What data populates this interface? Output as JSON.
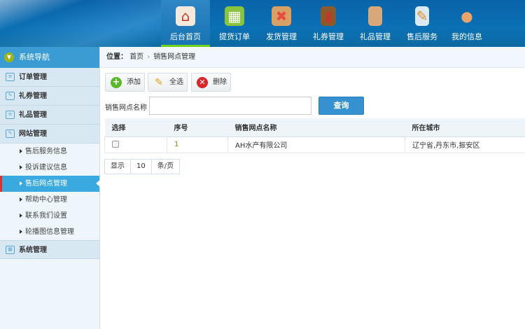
{
  "header": {
    "nav": [
      {
        "label": "后台首页",
        "icon": "house-icon",
        "active": true
      },
      {
        "label": "提货订单",
        "icon": "basket-icon"
      },
      {
        "label": "发货管理",
        "icon": "package-icon"
      },
      {
        "label": "礼券管理",
        "icon": "book-icon"
      },
      {
        "label": "礼品管理",
        "icon": "gift-bag-icon"
      },
      {
        "label": "售后服务",
        "icon": "document-pencil-icon"
      },
      {
        "label": "我的信息",
        "icon": "user-icon"
      }
    ]
  },
  "sidebar": {
    "title": "系统导航",
    "groups": [
      {
        "label": "订单管理"
      },
      {
        "label": "礼券管理"
      },
      {
        "label": "礼品管理"
      },
      {
        "label": "网站管理"
      }
    ],
    "sub": [
      {
        "label": "售后服务信息"
      },
      {
        "label": "投诉建议信息"
      },
      {
        "label": "售后网点管理",
        "active": true
      },
      {
        "label": "帮助中心管理"
      },
      {
        "label": "联系我们设置"
      },
      {
        "label": "轮播图信息管理"
      }
    ],
    "last_group": "系统管理"
  },
  "breadcrumb": {
    "prefix": "位置：",
    "home": "首页",
    "sep": "›",
    "current": "销售网点管理"
  },
  "toolbar": {
    "add": "添加",
    "select_all": "全选",
    "delete": "删除"
  },
  "search": {
    "label": "销售网点名称",
    "value": "",
    "button": "查询"
  },
  "table": {
    "headers": [
      "选择",
      "序号",
      "销售网点名称",
      "所在城市"
    ],
    "rows": [
      {
        "index": "1",
        "name": "AH水产有限公司",
        "city": "辽宁省,丹东市,振安区"
      }
    ]
  },
  "pager": {
    "show": "显示",
    "size": "10",
    "unit": "条/页"
  },
  "colors": {
    "header": "#0b6cb0",
    "accent": "#3aa9e0",
    "active_underline": "#6fd01c"
  }
}
